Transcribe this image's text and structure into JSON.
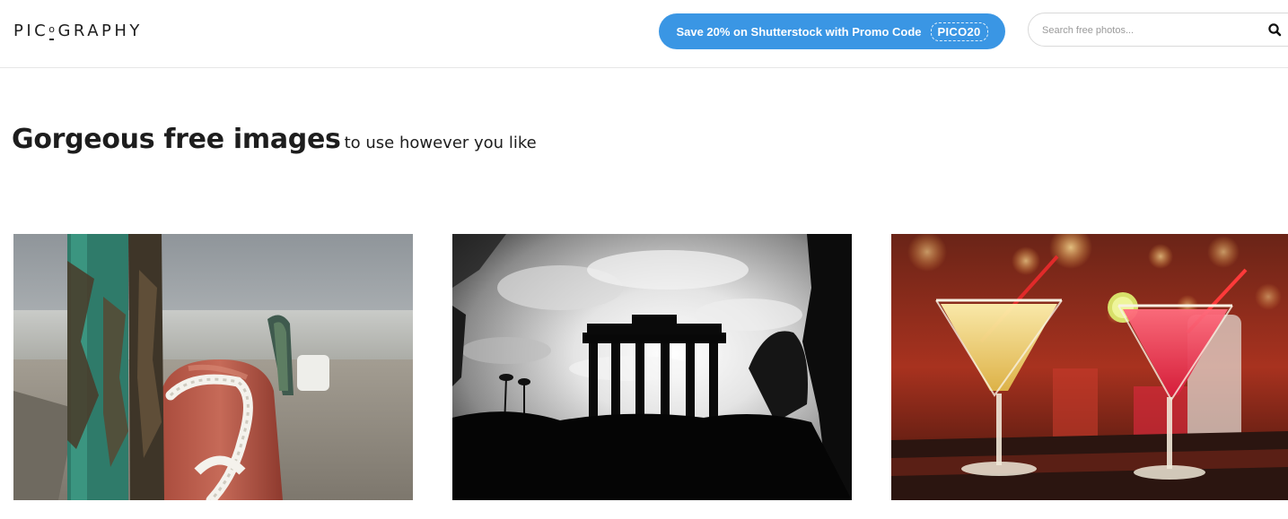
{
  "header": {
    "logo": {
      "before": "PIC",
      "o": "o",
      "after": "GRAPHY"
    },
    "promo": {
      "text": "Save 20% on Shutterstock with Promo Code",
      "code": "PICO20"
    },
    "search": {
      "placeholder": "Search free photos...",
      "icon": "search-icon"
    }
  },
  "hero": {
    "title": "Gorgeous free images",
    "subtitle": "to use however you like"
  },
  "photos": [
    {
      "name": "photo-harbor-bollard"
    },
    {
      "name": "photo-temple-silhouette"
    },
    {
      "name": "photo-cocktails"
    }
  ],
  "colors": {
    "promo_bg": "#3a96e4",
    "text": "#1d1d1d",
    "divider": "#e6e6e6"
  }
}
